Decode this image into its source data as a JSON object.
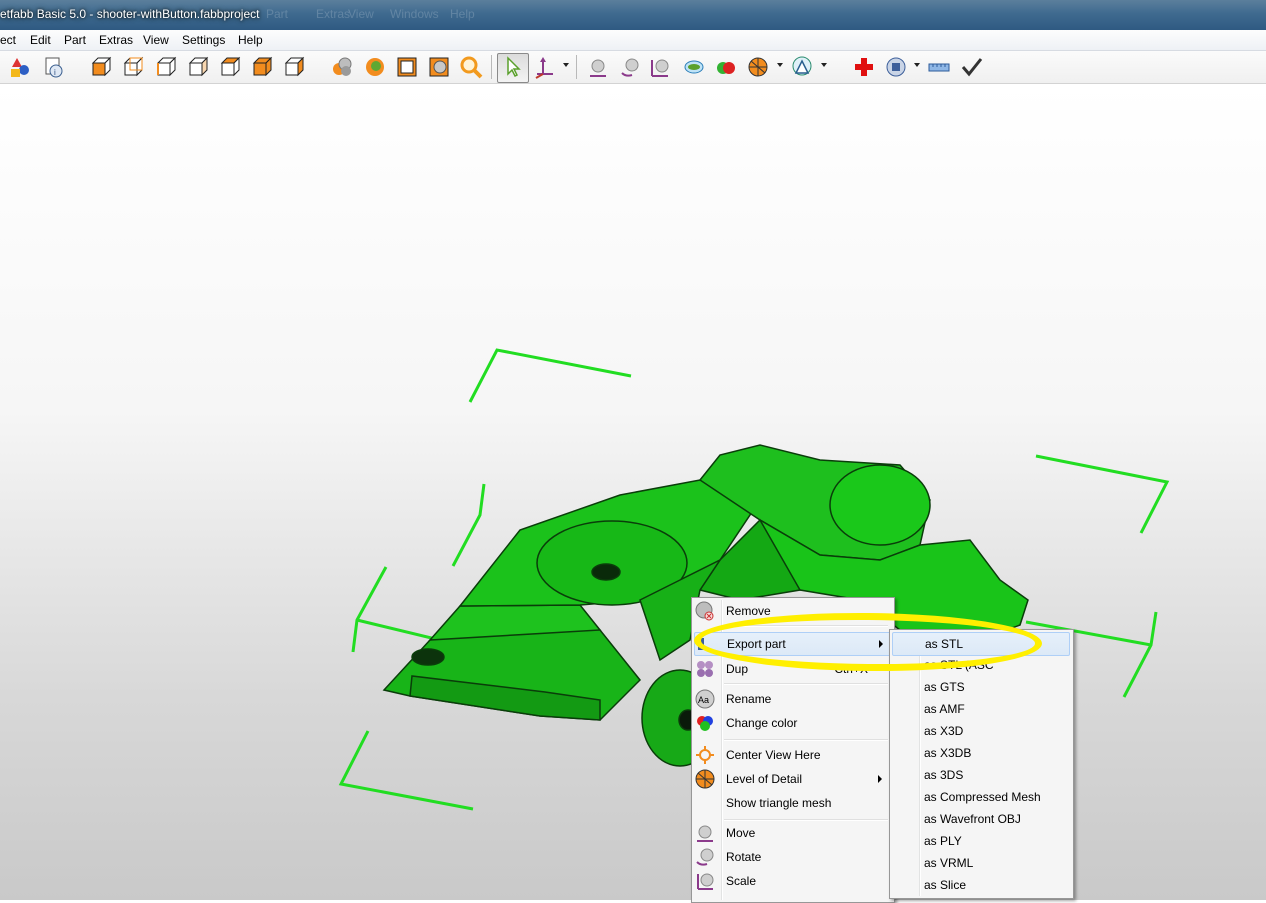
{
  "window": {
    "title": "etfabb Basic 5.0 - shooter-withButton.fabbproject",
    "ghost_menu": [
      "Part",
      "Extras",
      "View",
      "Windows",
      "Help"
    ]
  },
  "menubar": {
    "items": [
      {
        "label": "ect"
      },
      {
        "label": "Edit"
      },
      {
        "label": "Part"
      },
      {
        "label": "Extras"
      },
      {
        "label": "View"
      },
      {
        "label": "Settings"
      },
      {
        "label": "Help"
      }
    ]
  },
  "toolbar": {
    "icons": [
      "add-part-icon",
      "part-info-icon",
      "view-front-icon",
      "view-back-icon",
      "view-left-icon",
      "view-right-icon",
      "view-top-icon",
      "view-bottom-icon",
      "view-perspective-icon",
      "parts-group-icon",
      "parts-color-icon",
      "frame-view-icon",
      "section-view-icon",
      "zoom-icon",
      "select-pointer-icon",
      "measure-axis-icon",
      "move-icon",
      "rotate-icon",
      "scale-icon",
      "cut-icon",
      "repair-color-icon",
      "level-of-detail-icon",
      "triangle-mesh-icon",
      "repair-cross-icon",
      "render-icon",
      "ruler-icon",
      "checkmark-icon"
    ]
  },
  "context_menu": {
    "items": [
      {
        "label": "Remove",
        "icon": "remove-icon"
      },
      {
        "label": "Export part",
        "icon": "export-icon",
        "submenu": true,
        "highlighted": true
      },
      {
        "label": "Dup",
        "shortcut": "Ctrl+X",
        "icon": "duplicate-icon"
      },
      {
        "label": "Rename",
        "icon": "rename-icon"
      },
      {
        "label": "Change color",
        "icon": "color-icon"
      },
      {
        "label": "Center View Here",
        "icon": "center-view-icon"
      },
      {
        "label": "Level of Detail",
        "icon": "level-of-detail-icon",
        "submenu": true
      },
      {
        "label": "Show triangle mesh"
      },
      {
        "label": "Move",
        "icon": "move-icon"
      },
      {
        "label": "Rotate",
        "icon": "rotate-icon"
      },
      {
        "label": "Scale",
        "icon": "scale-icon"
      }
    ]
  },
  "export_submenu": {
    "items": [
      "as STL",
      "as STL (ASC",
      "as GTS",
      "as AMF",
      "as X3D",
      "as X3DB",
      "as 3DS",
      "as Compressed Mesh",
      "as Wavefront OBJ",
      "as PLY",
      "as VRML",
      "as Slice"
    ],
    "highlighted_index": 0,
    "annotation_color": "#ffef00"
  },
  "model": {
    "color": "#19c419",
    "bounding_box_color": "#22dd22"
  }
}
